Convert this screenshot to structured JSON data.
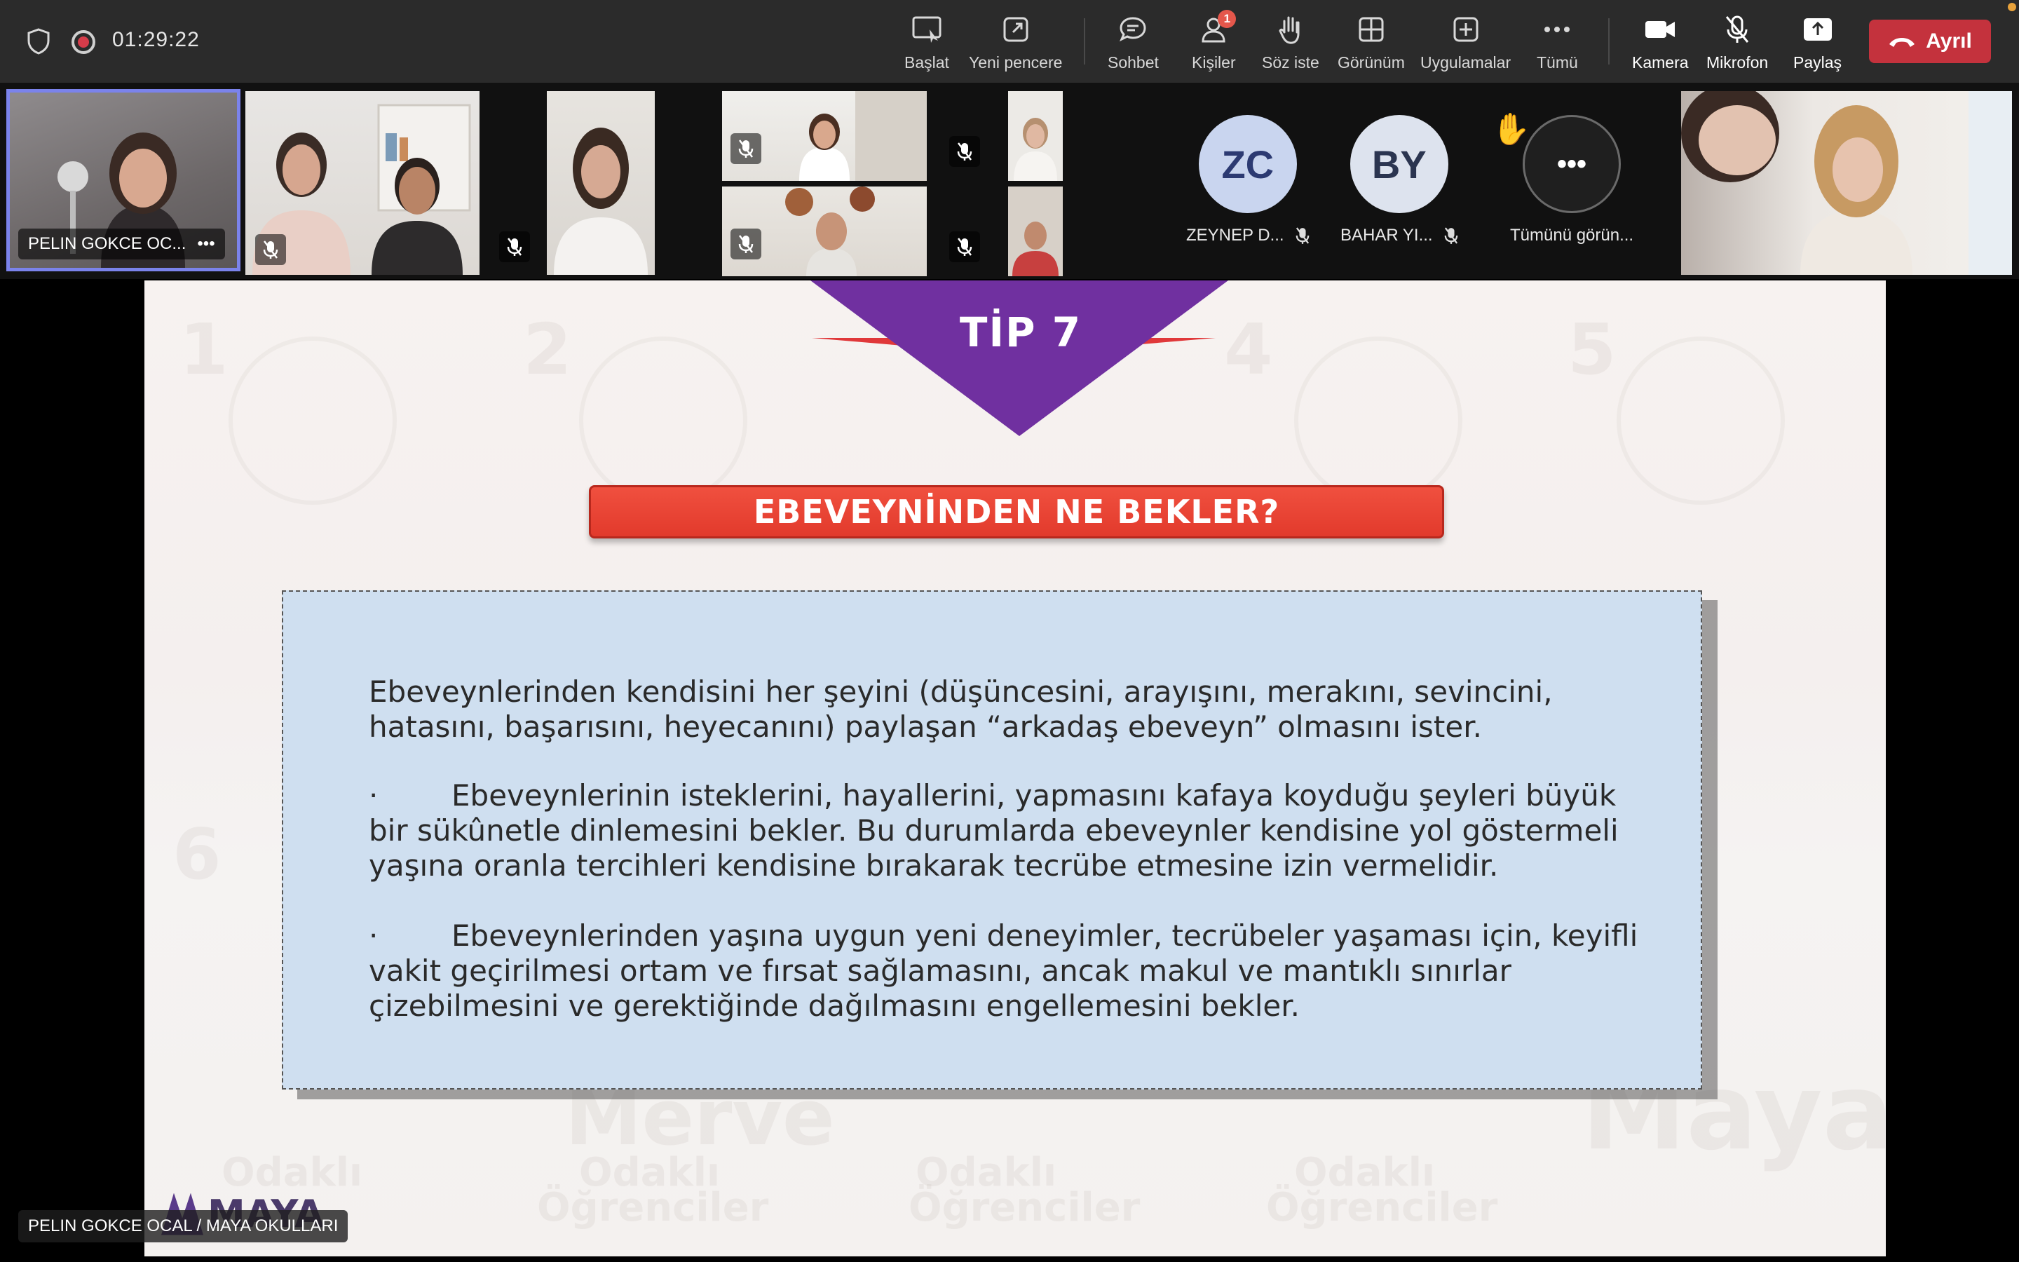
{
  "window": {
    "timer": "01:29:22"
  },
  "toolbar": {
    "start_label": "Başlat",
    "new_window_label": "Yeni pencere",
    "chat_label": "Sohbet",
    "people_label": "Kişiler",
    "people_badge": "1",
    "raise_hand_label": "Söz iste",
    "view_label": "Görünüm",
    "apps_label": "Uygulamalar",
    "more_label": "Tümü",
    "camera_label": "Kamera",
    "mic_label": "Mikrofon",
    "share_label": "Paylaş",
    "leave_label": "Ayrıl"
  },
  "participants": {
    "active_speaker": "PELIN GOKCE OC...",
    "more_options": "•••",
    "avatars": [
      {
        "initials": "ZC",
        "name": "ZEYNEP D...",
        "color": "#c9d5ef",
        "text_color": "#2c3a72"
      },
      {
        "initials": "BY",
        "name": "BAHAR YI...",
        "color": "#dde3ee",
        "text_color": "#2b3550"
      }
    ],
    "view_all_label": "Tümünü görün...",
    "view_all_icon": "•••"
  },
  "slide": {
    "tip": "TİP 7",
    "heading": "EBEVEYNİNDEN NE BEKLER?",
    "paragraph1": " Ebeveynlerinden kendisini her şeyini (düşüncesini, arayışını, merakını, sevincini, hatasını, başarısını, heyecanını) paylaşan “arkadaş ebeveyn” olmasını ister.",
    "bullet": "·",
    "paragraph2": "Ebeveynlerinin isteklerini, hayallerini, yapmasını kafaya koyduğu şeyleri büyük bir sükûnetle dinlemesini bekler. Bu durumlarda ebeveynler kendisine yol göstermeli yaşına oranla tercihleri kendisine bırakarak tecrübe etmesine izin vermelidir.",
    "paragraph3": "Ebeveynlerinden yaşına uygun yeni deneyimler, tecrübeler yaşaması için, keyifli vakit geçirilmesi ortam ve fırsat sağlamasını, ancak makul ve mantıklı sınırlar çizebilmesini ve gerektiğinde dağılmasını engellemesini bekler.",
    "logo_text": "MAYA",
    "bg_numbers": [
      "1",
      "2",
      "4",
      "5",
      "6"
    ],
    "bg_words": [
      "Odaklı",
      "Öğrenciler",
      "Merve",
      "Maya"
    ]
  },
  "presenter_label": "PELIN GOKCE OCAL / MAYA OKULLARI",
  "colors": {
    "toolbar_bg": "#2b2b2b",
    "leave_red": "#c4323d",
    "selected_outline": "#7b83eb",
    "tip_purple": "#7030a0",
    "heading_red": "#e23a2c",
    "textbox_blue": "#cfdff0"
  }
}
